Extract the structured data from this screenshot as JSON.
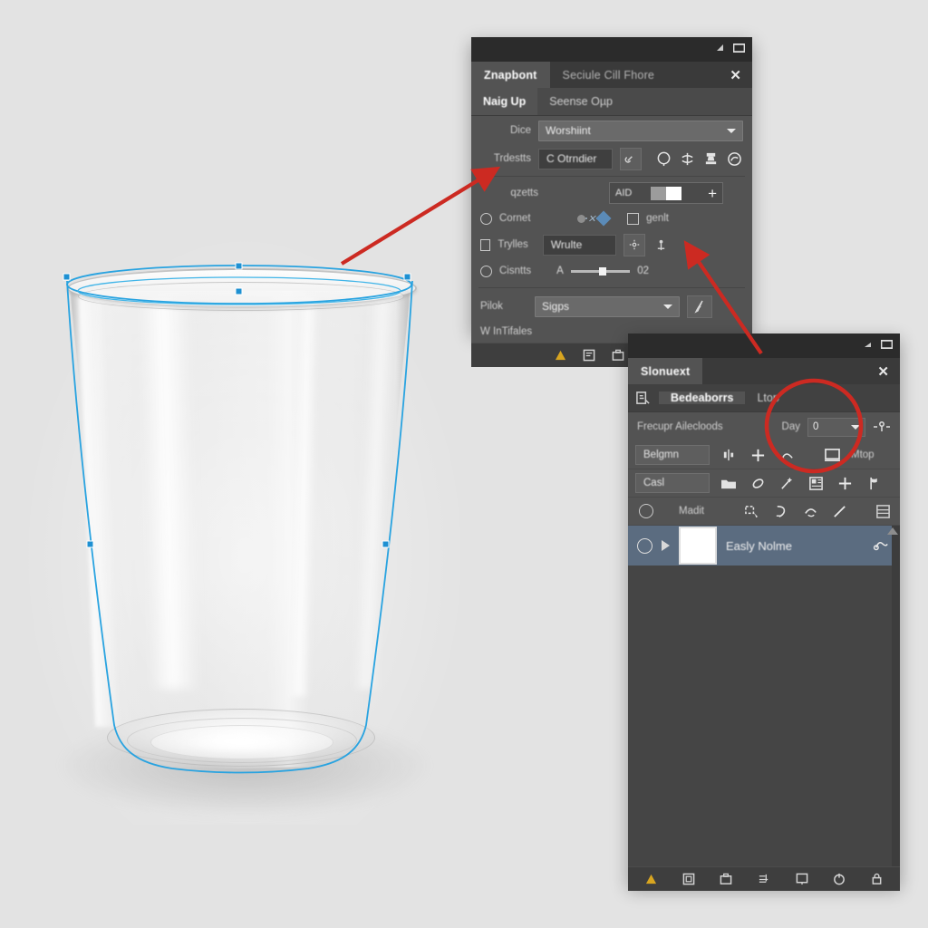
{
  "app": {
    "background_color": "#e2e2e2",
    "accent_selection_color": "#29a3e0",
    "annotation_color": "#cc2a22"
  },
  "canvas": {
    "subject": "drinking-glass-tumbler",
    "selection_path_label": "vector-selection-path"
  },
  "panel1": {
    "title": "Seciule Cill Fhore",
    "tab": "Znapbont",
    "close_label": "✕",
    "subtabs": [
      {
        "label": "Naig Up",
        "active": true
      },
      {
        "label": "Seense Oµp",
        "active": false
      }
    ],
    "rows": {
      "preset_label": "Dice",
      "preset_value": "Worshiint",
      "tools_label": "Trdestts",
      "tools_value": "C Otrndier",
      "tool_icons": [
        "link-icon",
        "lasso-icon",
        "blend-icon",
        "stamp-icon",
        "cloud-icon"
      ],
      "opts_label": "qzetts",
      "opts_mode": "AID",
      "opts_add_icon": "+",
      "comet_label": "Cornet",
      "comet_check_label": "genlt",
      "styles_label": "Trylles",
      "styles_value": "Wrulte",
      "counts_label": "Cisntts",
      "counts_prefix": "A",
      "counts_value": "02",
      "pilot_label": "Pilok",
      "pilot_value": "Sigps",
      "footer_label": "W InTifales"
    },
    "footer_icons": [
      "warning-icon",
      "note-icon",
      "camera-icon",
      "layers-icon",
      "mask-icon",
      "frame-icon",
      "lock-icon"
    ]
  },
  "panel2": {
    "title": "Slonuext",
    "close_label": "✕",
    "tabs": [
      {
        "label": "Bedeaborrs",
        "active": true
      },
      {
        "label": "Ltop",
        "active": false
      }
    ],
    "header": {
      "label": "Frecupr Ailecloods",
      "day_label": "Day",
      "day_value": "0"
    },
    "toolbar_rows": [
      {
        "button": "Belgmn",
        "icons": [
          "align-icon",
          "plus-icon",
          "curve-icon",
          "screen-icon"
        ],
        "trailing_label": "Mtop"
      },
      {
        "button": "Casl",
        "icons": [
          "folder-icon",
          "brush-icon",
          "wand-icon",
          "grid-icon",
          "plus-icon",
          "flag-icon"
        ],
        "trailing_label": ""
      },
      {
        "button": "",
        "icons": [
          "select-icon",
          "shape-icon",
          "curve-icon",
          "line-icon",
          "panel-icon"
        ],
        "trailing_label": "Madit"
      }
    ],
    "layer": {
      "name": "Easly Nolme",
      "fx_icon": "fx-icon"
    },
    "footer_icons": [
      "warning-icon",
      "note-icon",
      "camera-icon",
      "layers-icon",
      "mask-icon",
      "refresh-icon",
      "lock-icon"
    ]
  },
  "annotations": {
    "arrow1": "points-to-panel1-options-row",
    "arrow2": "points-to-panel1-pilot-row",
    "circle1": "highlights-panel2-day-and-mtop"
  }
}
